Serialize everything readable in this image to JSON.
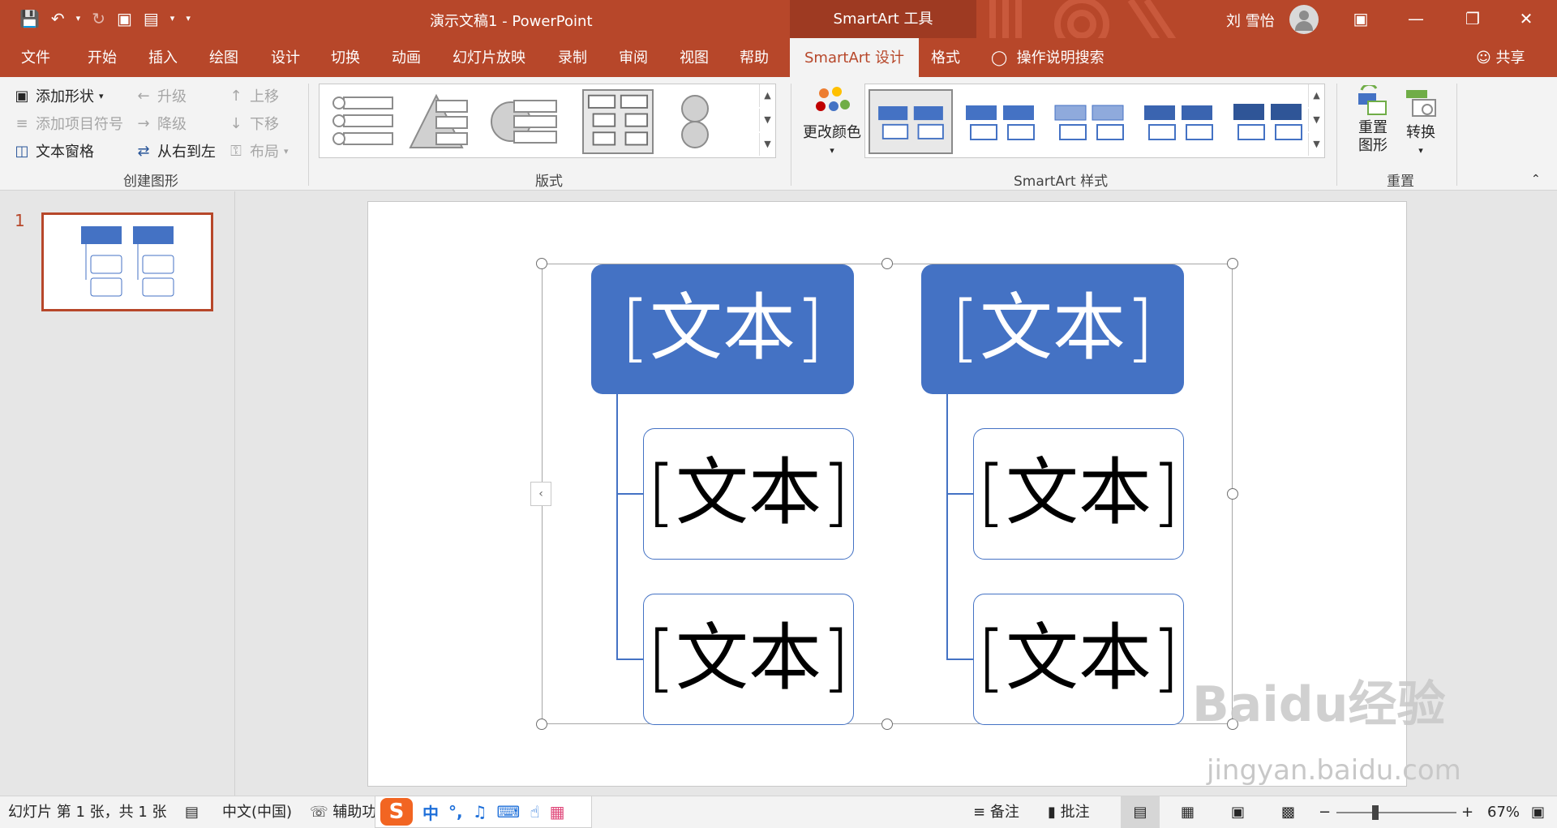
{
  "titlebar": {
    "doc_title": "演示文稿1  -  PowerPoint",
    "tools_tab": "SmartArt 工具",
    "user_name": "刘 雪怡",
    "qat_icons": [
      "save-icon",
      "undo-icon",
      "redo-icon",
      "present-icon",
      "layout-icon",
      "customize-icon"
    ]
  },
  "tabs": [
    "文件",
    "开始",
    "插入",
    "绘图",
    "设计",
    "切换",
    "动画",
    "幻灯片放映",
    "录制",
    "审阅",
    "视图",
    "帮助",
    "SmartArt 设计",
    "格式"
  ],
  "tell_me": "操作说明搜索",
  "share": "共享",
  "ribbon": {
    "create": {
      "add_shape": "添加形状",
      "add_bullet": "添加项目符号",
      "text_pane": "文本窗格",
      "promote": "升级",
      "demote": "降级",
      "right_to_left": "从右到左",
      "move_up": "上移",
      "move_down": "下移",
      "layout": "布局",
      "label": "创建图形"
    },
    "layouts": {
      "label": "版式"
    },
    "styles": {
      "change_colors": "更改颜色",
      "label": "SmartArt 样式"
    },
    "reset": {
      "reset_graphic": "重置图形",
      "convert": "转换",
      "label": "重置"
    }
  },
  "thumb": {
    "number": "1"
  },
  "slide": {
    "heads": [
      "[文本]",
      "[文本]"
    ],
    "children": [
      "[文本]",
      "[文本]",
      "[文本]",
      "[文本]"
    ]
  },
  "watermark": {
    "main": "Baidu经验",
    "sub": "jingyan.baidu.com"
  },
  "status": {
    "slide_info": "幻灯片 第 1 张，共 1 张",
    "language": "中文(中国)",
    "accessibility": "辅助功能",
    "notes": "备注",
    "comments": "批注",
    "zoom": "67%"
  },
  "ime": {
    "logo": "S",
    "mode": "中",
    "punct": "°,"
  }
}
